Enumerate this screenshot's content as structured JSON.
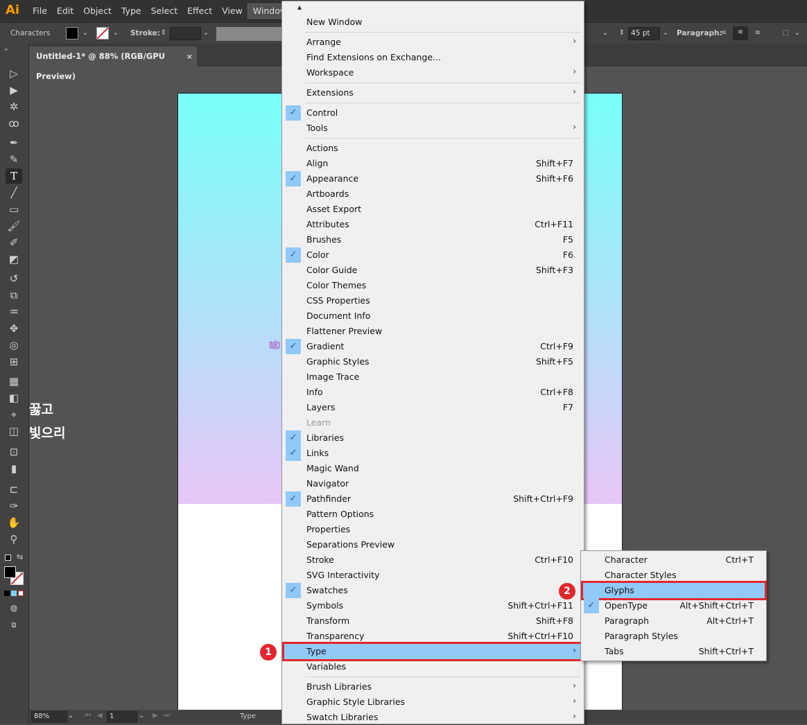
{
  "app": {
    "logo": "Ai"
  },
  "menubar": {
    "items": [
      "File",
      "Edit",
      "Object",
      "Type",
      "Select",
      "Effect",
      "View",
      "Window"
    ]
  },
  "controlbar": {
    "panel_label": "Characters",
    "stroke_label": "Stroke:",
    "font_size": "45 pt",
    "paragraph_label": "Paragraph:"
  },
  "document": {
    "tab_title": "Untitled-1* @ 88% (RGB/GPU Preview)",
    "close": "×"
  },
  "canvas": {
    "vertical_char": "을",
    "korean_line1": "꿇고",
    "korean_line2": "빛으리",
    "gradient_colors": [
      "#78FFFA",
      "#E8C6F7"
    ]
  },
  "statusbar": {
    "zoom": "88%",
    "page": "1",
    "tool": "Type"
  },
  "window_menu": {
    "items": [
      {
        "label": "New Window"
      },
      {
        "label": "Arrange",
        "submenu": true
      },
      {
        "label": "Find Extensions on Exchange..."
      },
      {
        "label": "Workspace",
        "submenu": true
      },
      {
        "label": "Extensions",
        "submenu": true
      },
      {
        "label": "Control",
        "checked": true
      },
      {
        "label": "Tools",
        "submenu": true
      },
      {
        "label": "Actions"
      },
      {
        "label": "Align",
        "shortcut": "Shift+F7"
      },
      {
        "label": "Appearance",
        "shortcut": "Shift+F6",
        "checked": true
      },
      {
        "label": "Artboards"
      },
      {
        "label": "Asset Export"
      },
      {
        "label": "Attributes",
        "shortcut": "Ctrl+F11"
      },
      {
        "label": "Brushes",
        "shortcut": "F5"
      },
      {
        "label": "Color",
        "shortcut": "F6",
        "checked": true
      },
      {
        "label": "Color Guide",
        "shortcut": "Shift+F3"
      },
      {
        "label": "Color Themes"
      },
      {
        "label": "CSS Properties"
      },
      {
        "label": "Document Info"
      },
      {
        "label": "Flattener Preview"
      },
      {
        "label": "Gradient",
        "shortcut": "Ctrl+F9",
        "checked": true
      },
      {
        "label": "Graphic Styles",
        "shortcut": "Shift+F5"
      },
      {
        "label": "Image Trace"
      },
      {
        "label": "Info",
        "shortcut": "Ctrl+F8"
      },
      {
        "label": "Layers",
        "shortcut": "F7"
      },
      {
        "label": "Learn",
        "disabled": true
      },
      {
        "label": "Libraries",
        "checked": true
      },
      {
        "label": "Links",
        "checked": true
      },
      {
        "label": "Magic Wand"
      },
      {
        "label": "Navigator"
      },
      {
        "label": "Pathfinder",
        "shortcut": "Shift+Ctrl+F9",
        "checked": true
      },
      {
        "label": "Pattern Options"
      },
      {
        "label": "Properties"
      },
      {
        "label": "Separations Preview"
      },
      {
        "label": "Stroke",
        "shortcut": "Ctrl+F10"
      },
      {
        "label": "SVG Interactivity"
      },
      {
        "label": "Swatches",
        "checked": true
      },
      {
        "label": "Symbols",
        "shortcut": "Shift+Ctrl+F11"
      },
      {
        "label": "Transform",
        "shortcut": "Shift+F8"
      },
      {
        "label": "Transparency",
        "shortcut": "Shift+Ctrl+F10"
      },
      {
        "label": "Type",
        "submenu": true,
        "highlighted": true
      },
      {
        "label": "Variables"
      },
      {
        "label": "Brush Libraries",
        "submenu": true
      },
      {
        "label": "Graphic Style Libraries",
        "submenu": true
      },
      {
        "label": "Swatch Libraries",
        "submenu": true
      }
    ]
  },
  "type_submenu": {
    "items": [
      {
        "label": "Character",
        "shortcut": "Ctrl+T"
      },
      {
        "label": "Character Styles"
      },
      {
        "label": "Glyphs",
        "highlighted": true
      },
      {
        "label": "OpenType",
        "shortcut": "Alt+Shift+Ctrl+T",
        "checked": true
      },
      {
        "label": "Paragraph",
        "shortcut": "Alt+Ctrl+T"
      },
      {
        "label": "Paragraph Styles"
      },
      {
        "label": "Tabs",
        "shortcut": "Shift+Ctrl+T"
      }
    ]
  },
  "annotations": {
    "step1": "1",
    "step2": "2",
    "color": "#E3262E"
  },
  "icons": [
    "selection-icon",
    "direct-selection-icon",
    "magic-wand-icon",
    "lasso-icon",
    "pen-icon",
    "curvature-icon",
    "type-icon",
    "line-icon",
    "rectangle-icon",
    "paintbrush-icon",
    "shaper-icon",
    "eraser-icon",
    "rotate-icon",
    "scale-icon",
    "warp-icon",
    "free-transform-icon",
    "shape-builder-icon",
    "perspective-icon",
    "mesh-icon",
    "gradient-icon",
    "eyedropper-icon",
    "blend-icon",
    "symbol-sprayer-icon",
    "graph-icon",
    "artboard-icon",
    "slice-icon",
    "hand-icon",
    "zoom-icon"
  ]
}
